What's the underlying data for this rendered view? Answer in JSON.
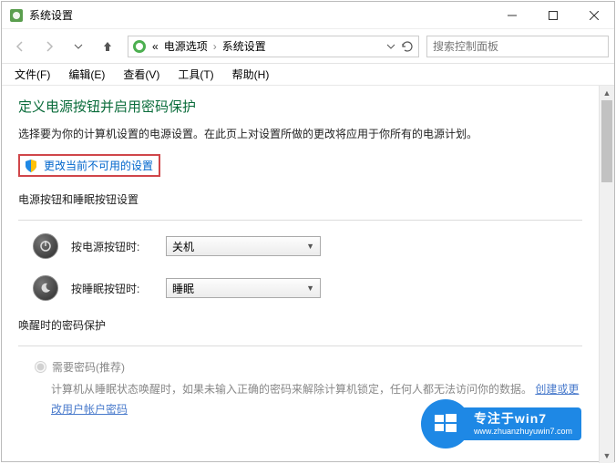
{
  "window": {
    "title": "系统设置"
  },
  "breadcrumb": {
    "prefix": "«",
    "item1": "电源选项",
    "sep": "›",
    "item2": "系统设置"
  },
  "search": {
    "placeholder": "搜索控制面板"
  },
  "menu": {
    "file": "文件(F)",
    "edit": "编辑(E)",
    "view": "查看(V)",
    "tools": "工具(T)",
    "help": "帮助(H)"
  },
  "page": {
    "title": "定义电源按钮并启用密码保护",
    "desc": "选择要为你的计算机设置的电源设置。在此页上对设置所做的更改将应用于你所有的电源计划。",
    "change_link": "更改当前不可用的设置"
  },
  "section_buttons": {
    "label": "电源按钮和睡眠按钮设置",
    "power_label": "按电源按钮时:",
    "power_value": "关机",
    "sleep_label": "按睡眠按钮时:",
    "sleep_value": "睡眠"
  },
  "section_password": {
    "label": "唤醒时的密码保护",
    "radio_label": "需要密码(推荐)",
    "desc_prefix": "计算机从睡眠状态唤醒时，如果未输入正确的密码来解除计算机锁定，任何人都无法访问你的数据。",
    "link": "创建或更改用户帐户密码"
  },
  "badge": {
    "line1": "专注于win7",
    "line2": "www.zhuanzhuyuwin7.com"
  }
}
